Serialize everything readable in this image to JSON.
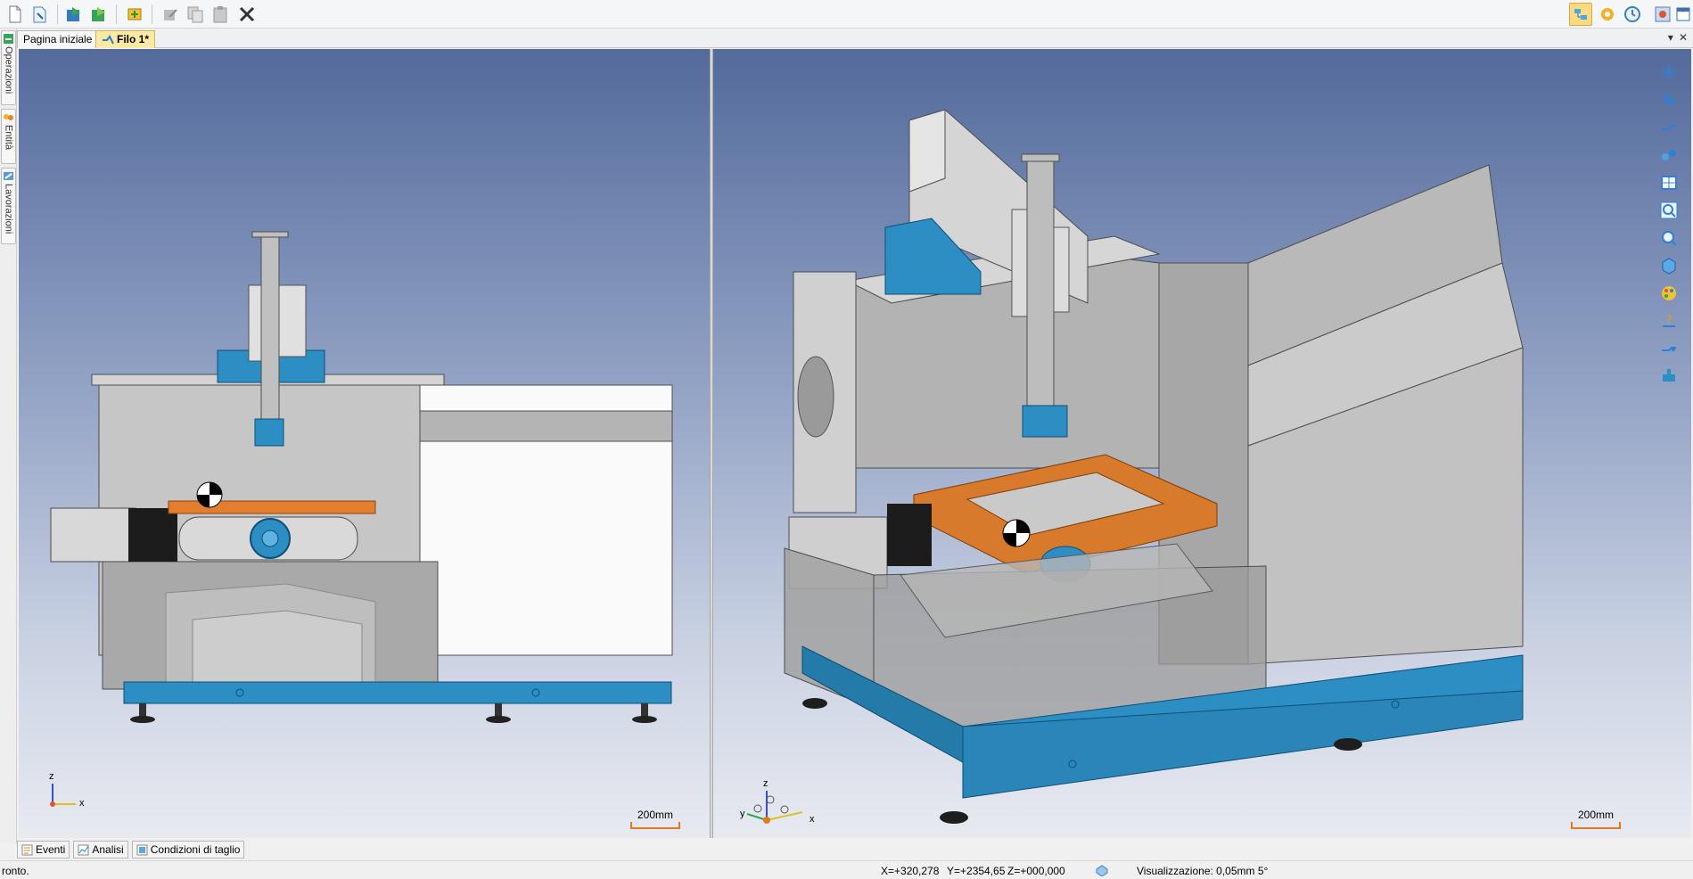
{
  "toolbar": {
    "left_icons": [
      "new-document-icon",
      "open-document-icon",
      "save-icon",
      "save-as-icon",
      "compile-icon",
      "edit-icon",
      "copy-icon",
      "paste-icon",
      "delete-icon"
    ],
    "right_icons": [
      "wire-view-icon",
      "simulation-icon",
      "clock-icon",
      "settings-icon"
    ]
  },
  "left_dock": {
    "tabs": [
      {
        "label": "Operazioni",
        "icon": "operations-icon"
      },
      {
        "label": "Entità",
        "icon": "entities-icon"
      },
      {
        "label": "Lavorazioni",
        "icon": "machining-icon"
      }
    ]
  },
  "document_tabs": [
    {
      "label": "Pagina iniziale",
      "active": false
    },
    {
      "label": "Filo 1*",
      "active": true,
      "icon": "wire-icon"
    }
  ],
  "views": {
    "left": {
      "scale_label": "200mm",
      "axis": {
        "z": "z",
        "x": "x"
      }
    },
    "right": {
      "scale_label": "200mm",
      "axis": {
        "z": "z",
        "y": "y",
        "x": "x"
      }
    }
  },
  "view_tools": [
    "add-point-icon",
    "move-icon",
    "wire-path-icon",
    "link-icon",
    "layout-icon",
    "zoom-window-icon",
    "zoom-icon",
    "view-cube-icon",
    "color-palette-icon",
    "help-icon",
    "wire-options-icon",
    "machine-icon"
  ],
  "bottom_tabs": [
    {
      "label": "Eventi",
      "icon": "events-icon"
    },
    {
      "label": "Analisi",
      "icon": "analysis-icon"
    },
    {
      "label": "Condizioni di taglio",
      "icon": "cutting-conditions-icon"
    }
  ],
  "status": {
    "message": "ronto.",
    "x": "X=+320,278",
    "y": "Y=+2354,65",
    "z": "Z=+000,000",
    "visualization": "Visualizzazione: 0,05mm 5°"
  },
  "colors": {
    "machine_blue": "#2d8ec4",
    "table_orange": "#d87a2c",
    "machine_grey": "#c8c8c8",
    "viewport_top": "#536a9b",
    "viewport_bottom": "#e8eaf0"
  }
}
